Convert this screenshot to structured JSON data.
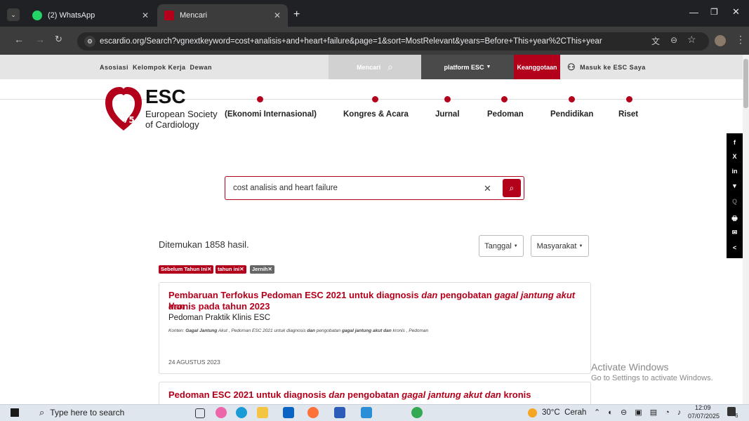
{
  "browser": {
    "tabs": [
      {
        "label": "(2) WhatsApp"
      },
      {
        "label": "Mencari"
      }
    ],
    "url": "escardio.org/Search?vgnextkeyword=cost+analisis+and+heart+failure&page=1&sort=MostRelevant&years=Before+This+year%2CThis+year",
    "new_tab": "+"
  },
  "esc_topbar": {
    "links": "Asosiasi  Kelompok Kerja  Dewan",
    "search": "Mencari",
    "platform": "platform ESC",
    "membership": "Keanggotaan",
    "login": "Masuk ke ESC Saya"
  },
  "logo": {
    "abbr": "ESC",
    "name_line1": "European Society",
    "name_line2": "of Cardiology",
    "badge": "75"
  },
  "nav": [
    {
      "label": "(Ekonomi Internasional)"
    },
    {
      "label": "Kongres & Acara"
    },
    {
      "label": "Jurnal"
    },
    {
      "label": "Pedoman"
    },
    {
      "label": "Pendidikan"
    },
    {
      "label": "Riset"
    }
  ],
  "social": [
    "f",
    "X",
    "in",
    "▼",
    "Q",
    "🖶",
    "✉",
    "<"
  ],
  "search": {
    "value": "cost analisis and heart failure"
  },
  "results_count": "Ditemukan 1858 hasil.",
  "filters": {
    "date": "Tanggal",
    "community": "Masyarakat"
  },
  "chips": [
    {
      "label": "Sebelum Tahun Ini"
    },
    {
      "label": "tahun ini"
    },
    {
      "label": "Jernih"
    }
  ],
  "results": [
    {
      "title_a": "Pembaruan Terfokus Pedoman ESC 2021 untuk diagnosis ",
      "title_b": "dan",
      "title_c": " pengobatan ",
      "title_d": "gagal jantung akut dan",
      "title_e": "kronis pada tahun 2023",
      "subtitle": "Pedoman Praktik Klinis ESC",
      "content_label": "Konten: ",
      "content_b1": "Gagal Jantung",
      "content_t1": " Akut , Pedoman ESC 2021 untuk diagnosis ",
      "content_b2": "dan",
      "content_t2": " pengobatan ",
      "content_b3": "gagal jantung akut dan",
      "content_t3": " kronis , Pedoman",
      "date": "24 AGUSTUS 2023"
    },
    {
      "title_a": "Pedoman ESC 2021 untuk diagnosis ",
      "title_b": "dan",
      "title_c": " pengobatan ",
      "title_d": "gagal jantung akut dan",
      "title_e": " kronis"
    }
  ],
  "windows_watermark": {
    "line1": "Activate Windows",
    "line2": "Go to Settings to activate Windows."
  },
  "taskbar": {
    "search_placeholder": "Type here to search",
    "weather": "30°C  Cerah",
    "time": "12:09",
    "date": "07/07/2025",
    "notif": "6"
  },
  "colors": {
    "brand": "#b3001b",
    "chrome_dark": "#202124"
  }
}
